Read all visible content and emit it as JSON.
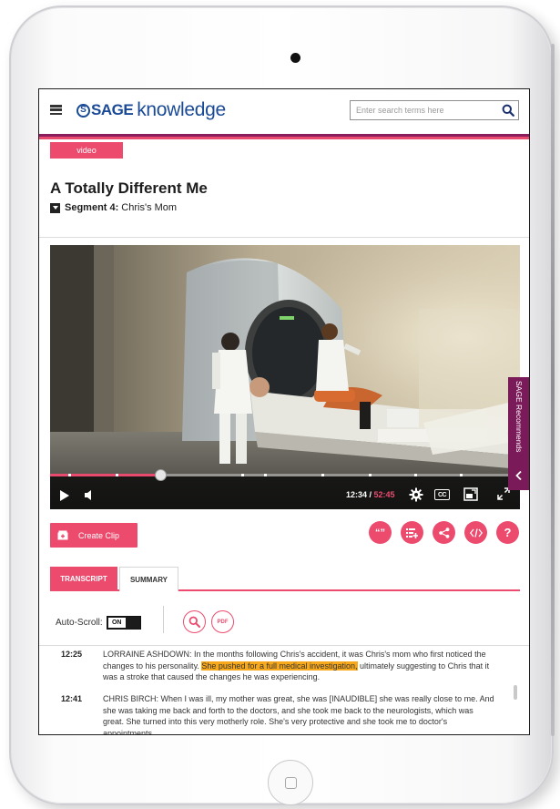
{
  "header": {
    "logo_mark": "S",
    "logo_sage": "SAGE",
    "logo_knowledge": "knowledge",
    "search_placeholder": "Enter search terms here"
  },
  "content_type_badge": "video",
  "video": {
    "title": "A Totally Different Me",
    "segment_label": "Segment 4:",
    "segment_name": "Chris's Mom",
    "current_time": "12:34",
    "separator": " / ",
    "total_time": "52:45",
    "progress_fraction": 0.235,
    "cc_label": "CC"
  },
  "sidebar_tab": {
    "label": "SAGE Recommends"
  },
  "actions": {
    "create_clip_label": "Create Clip",
    "cite_icon_text": "“”",
    "help_icon_text": "?"
  },
  "tabs": [
    {
      "label": "TRANSCRIPT",
      "active": true
    },
    {
      "label": "SUMMARY",
      "active": false
    }
  ],
  "transcript_tools": {
    "autoscroll_label": "Auto-Scroll:",
    "autoscroll_state": "ON",
    "pdf_label": "PDF"
  },
  "transcript": [
    {
      "time": "12:25",
      "before": "LORRAINE ASHDOWN: In the months following Chris's accident, it was Chris's mom who first noticed the changes to his personality. ",
      "highlight": "She pushed for a full medical investigation,",
      "after": " ultimately suggesting to Chris that it was a stroke that caused the changes he was experiencing."
    },
    {
      "time": "12:41",
      "before": "CHRIS BIRCH: When I was ill, my mother was great, she was [INAUDIBLE] she was really close to me. And she was taking me back and forth to the doctors, and she took me back to the neurologists, which was great. She turned into this very motherly role. She's very protective and she took me to doctor's appointments.",
      "highlight": "",
      "after": ""
    }
  ],
  "colors": {
    "accent": "#ec4b6e",
    "brand_blue": "#1a4a96",
    "brand_purple": "#7a1a59",
    "highlight": "#f7a81b"
  }
}
